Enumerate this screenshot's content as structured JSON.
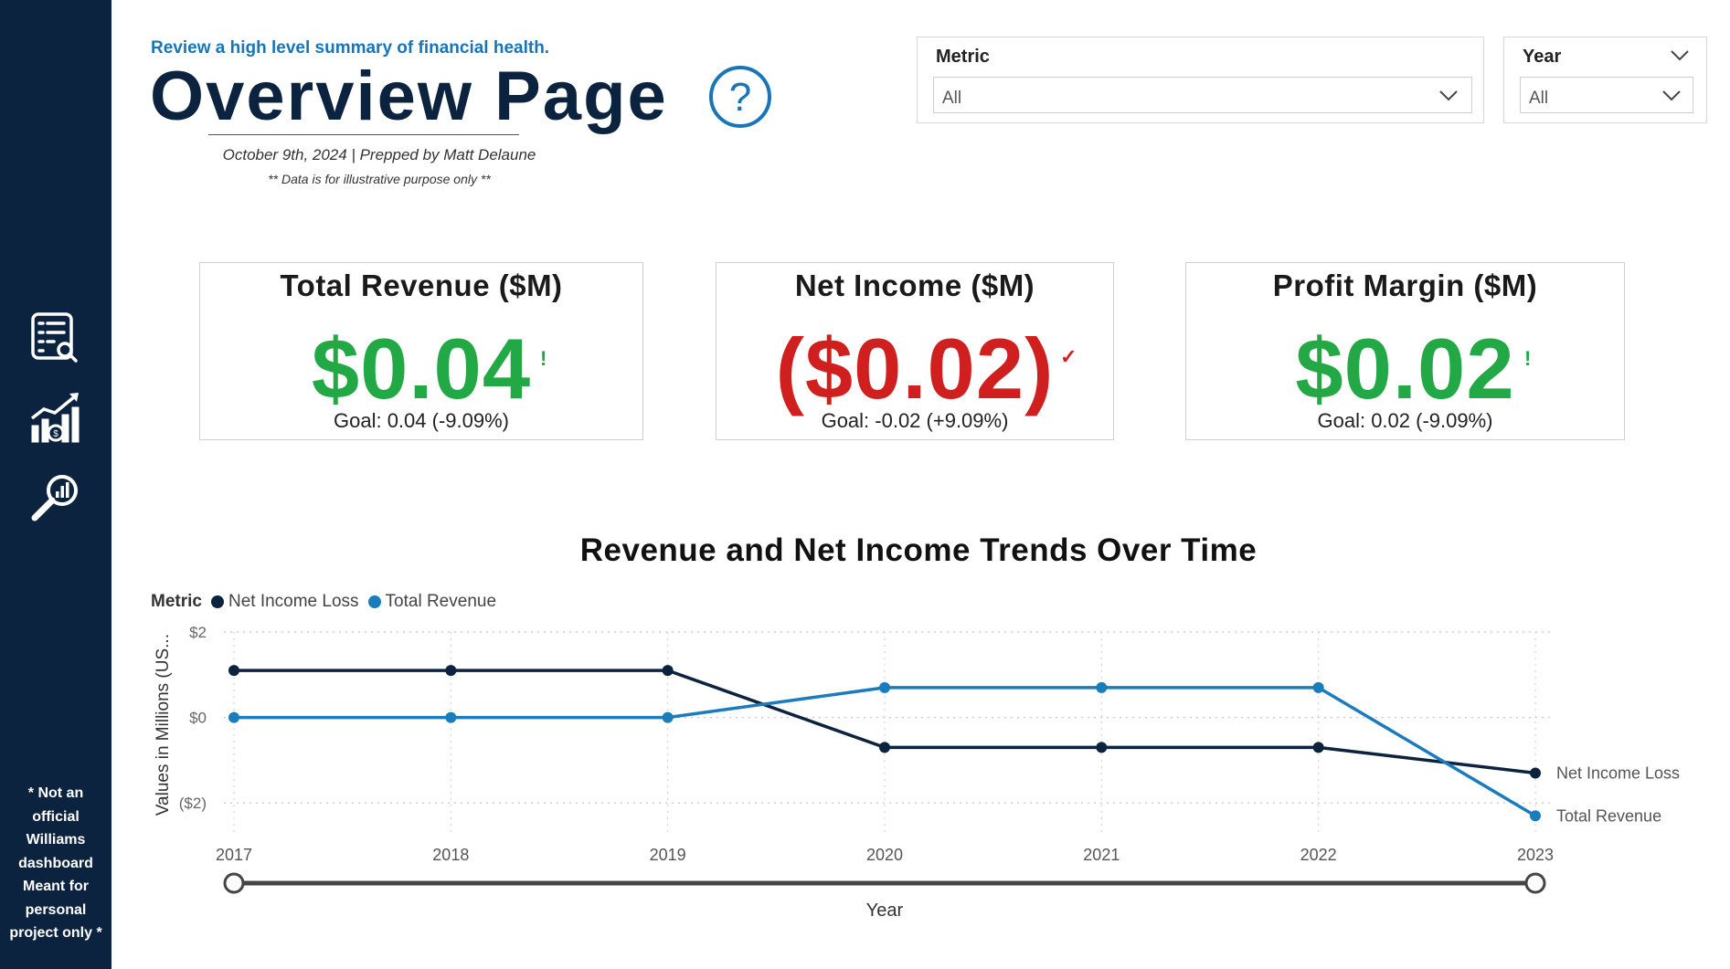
{
  "sidebar": {
    "icons": [
      "report-search-icon",
      "financial-growth-chart-icon",
      "analytics-magnifier-icon"
    ],
    "disclaimer": [
      "* Not an",
      "official",
      "Williams",
      "dashboard",
      "Meant for",
      "personal",
      "project only *"
    ]
  },
  "header": {
    "subtitle": "Review a high level summary of financial health.",
    "title": "Overview Page",
    "date_line": "October 9th, 2024 | Prepped by Matt Delaune",
    "note_line": "** Data is for illustrative purpose only **"
  },
  "filters": {
    "metric": {
      "label": "Metric",
      "value": "All"
    },
    "year": {
      "label": "Year",
      "value": "All"
    }
  },
  "kpis": [
    {
      "title": "Total Revenue ($M)",
      "value": "$0.04",
      "status": "!",
      "goal": "Goal: 0.04 (-9.09%)",
      "value_color": "#22a845",
      "status_color": "#22a845"
    },
    {
      "title": "Net Income ($M)",
      "value": "($0.02)",
      "status": "✓",
      "goal": "Goal: -0.02 (+9.09%)",
      "value_color": "#d01f1f",
      "status_color": "#d01f1f"
    },
    {
      "title": "Profit Margin ($M)",
      "value": "$0.02",
      "status": "!",
      "goal": "Goal: 0.02 (-9.09%)",
      "value_color": "#22a845",
      "status_color": "#22a845"
    }
  ],
  "chart_title": "Revenue and Net Income Trends Over Time",
  "colors": {
    "sidebar": "#0c2340",
    "net_income": "#0c2340",
    "total_revenue": "#1a7bbd"
  },
  "chart_data": {
    "type": "line",
    "title": "Revenue and Net Income Trends Over Time",
    "xlabel": "Year",
    "ylabel": "Values in Millions (US...",
    "legend_title": "Metric",
    "x": [
      "2017",
      "2018",
      "2019",
      "2020",
      "2021",
      "2022",
      "2023"
    ],
    "y_ticks": [
      "$2",
      "$0",
      "($2)"
    ],
    "y_tick_values": [
      2,
      0,
      -2
    ],
    "ylim": [
      -2.7,
      2
    ],
    "grid": true,
    "legend_position": "top-left",
    "series": [
      {
        "name": "Net Income Loss",
        "color": "#0c2340",
        "values": [
          1.1,
          1.1,
          1.1,
          -0.7,
          -0.7,
          -0.7,
          -1.3
        ]
      },
      {
        "name": "Total Revenue",
        "color": "#1a7bbd",
        "values": [
          0.0,
          0.0,
          0.0,
          0.7,
          0.7,
          0.7,
          -2.3
        ]
      }
    ]
  }
}
